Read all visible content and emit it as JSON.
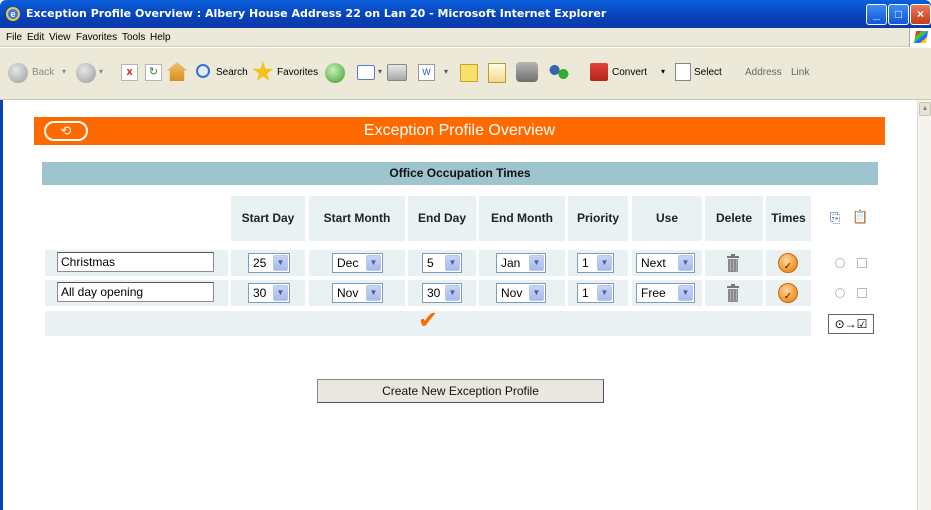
{
  "window": {
    "title": "Exception Profile Overview : Albery House Address 22 on Lan 20 - Microsoft Internet Explorer"
  },
  "menu": [
    "File",
    "Edit",
    "View",
    "Favorites",
    "Tools",
    "Help"
  ],
  "toolbar": {
    "back": "Back",
    "search": "Search",
    "favorites": "Favorites",
    "convert": "Convert",
    "select": "Select",
    "address": "Address",
    "links": "Link"
  },
  "page": {
    "title": "Exception Profile Overview",
    "section": "Office Occupation Times"
  },
  "columns": [
    "Start Day",
    "Start Month",
    "End Day",
    "End Month",
    "Priority",
    "Use",
    "Delete",
    "Times"
  ],
  "rows": [
    {
      "name": "Christmas",
      "start_day": "25",
      "start_month": "Dec",
      "end_day": "5",
      "end_month": "Jan",
      "priority": "1",
      "use": "Next"
    },
    {
      "name": "All day opening",
      "start_day": "30",
      "start_month": "Nov",
      "end_day": "30",
      "end_month": "Nov",
      "priority": "1",
      "use": "Free"
    }
  ],
  "create_button": "Create New Exception Profile",
  "colors": {
    "accent": "#ff6a00",
    "section": "#9dc4cf",
    "cell": "#eaf1f3"
  }
}
